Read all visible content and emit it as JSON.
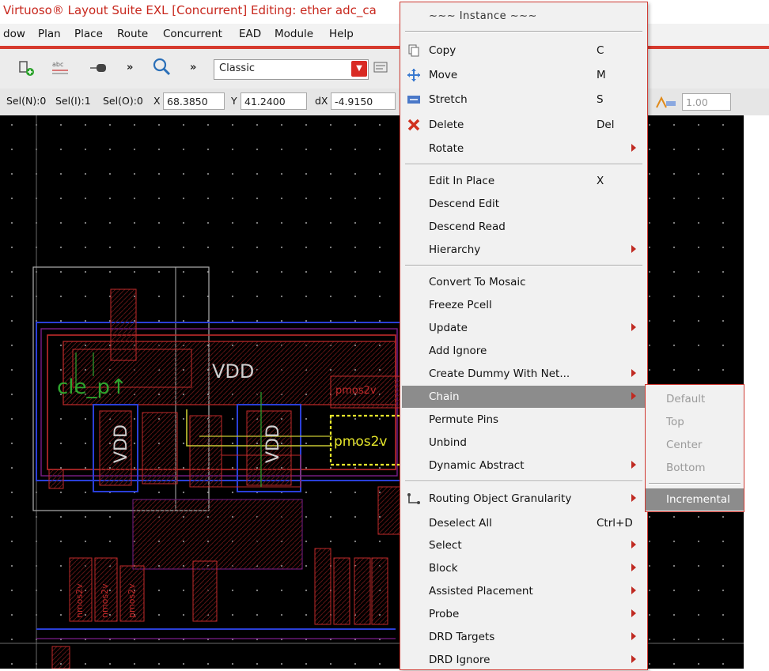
{
  "window": {
    "title": "Virtuoso® Layout Suite EXL [Concurrent] Editing: ether adc_ca"
  },
  "menubar": {
    "items": [
      "dow",
      "Plan",
      "Place",
      "Route",
      "Concurrent",
      "EAD",
      "Module",
      "Help"
    ]
  },
  "toolbar": {
    "mode_select": "Classic",
    "icons": [
      "create-instance-icon",
      "create-label-icon",
      "create-pin-icon",
      "more-icon",
      "zoom-icon",
      "more-icon",
      "options-icon"
    ],
    "more_glyph": "»",
    "right_value": "1.00"
  },
  "coordbar": {
    "sel_n": "Sel(N):0",
    "sel_i": "Sel(I):1",
    "sel_o": "Sel(O):0",
    "x_label": "X",
    "x_value": "68.3850",
    "y_label": "Y",
    "y_value": "41.2400",
    "dx_label": "dX",
    "dx_value": "-4.9150"
  },
  "canvas": {
    "labels": {
      "vdd_top": "VDD",
      "cle": "cle_p↑",
      "vdd_rot1": "VDD",
      "vdd_rot2": "VDD",
      "pmos_sel": "pmos2v",
      "pmos_top": "pmos2v",
      "nmos_a": "nmos2v",
      "nmos_b": "nmos2v",
      "pmos_c": "pmos2v"
    },
    "colors": {
      "background": "#000000",
      "grid": "#8a8a8a",
      "metal1": "#2a3fd8",
      "poly": "#c02a2a",
      "selection": "#e6e62a",
      "outline": "#b0b0b0"
    }
  },
  "context_menu": {
    "header": "~~~ Instance ~~~",
    "groups": [
      [
        {
          "label": "Copy",
          "shortcut": "C",
          "icon": "copy-icon",
          "submenu": false
        },
        {
          "label": "Move",
          "shortcut": "M",
          "icon": "move-icon",
          "submenu": false
        },
        {
          "label": "Stretch",
          "shortcut": "S",
          "icon": "stretch-icon",
          "submenu": false
        },
        {
          "label": "Delete",
          "shortcut": "Del",
          "icon": "delete-icon",
          "submenu": false
        },
        {
          "label": "Rotate",
          "shortcut": "",
          "icon": "",
          "submenu": true
        }
      ],
      [
        {
          "label": "Edit In Place",
          "shortcut": "X",
          "icon": "",
          "submenu": false
        },
        {
          "label": "Descend Edit",
          "shortcut": "",
          "icon": "",
          "submenu": false
        },
        {
          "label": "Descend Read",
          "shortcut": "",
          "icon": "",
          "submenu": false
        },
        {
          "label": "Hierarchy",
          "shortcut": "",
          "icon": "",
          "submenu": true
        }
      ],
      [
        {
          "label": "Convert To Mosaic",
          "shortcut": "",
          "icon": "",
          "submenu": false
        },
        {
          "label": "Freeze Pcell",
          "shortcut": "",
          "icon": "",
          "submenu": false
        },
        {
          "label": "Update",
          "shortcut": "",
          "icon": "",
          "submenu": true
        },
        {
          "label": "Add Ignore",
          "shortcut": "",
          "icon": "",
          "submenu": false
        },
        {
          "label": "Create Dummy With Net...",
          "shortcut": "",
          "icon": "",
          "submenu": true
        },
        {
          "label": "Chain",
          "shortcut": "",
          "icon": "",
          "submenu": true,
          "highlighted": true
        },
        {
          "label": "Permute Pins",
          "shortcut": "",
          "icon": "",
          "submenu": false
        },
        {
          "label": "Unbind",
          "shortcut": "",
          "icon": "",
          "submenu": false
        },
        {
          "label": "Dynamic Abstract",
          "shortcut": "",
          "icon": "",
          "submenu": true
        }
      ],
      [
        {
          "label": "Routing Object Granularity",
          "shortcut": "",
          "icon": "routing-granularity-icon",
          "submenu": true
        },
        {
          "label": "Deselect All",
          "shortcut": "Ctrl+D",
          "icon": "",
          "submenu": false
        },
        {
          "label": "Select",
          "shortcut": "",
          "icon": "",
          "submenu": true
        },
        {
          "label": "Block",
          "shortcut": "",
          "icon": "",
          "submenu": true
        },
        {
          "label": "Assisted Placement",
          "shortcut": "",
          "icon": "",
          "submenu": true
        },
        {
          "label": "Probe",
          "shortcut": "",
          "icon": "",
          "submenu": true
        },
        {
          "label": "DRD Targets",
          "shortcut": "",
          "icon": "",
          "submenu": true
        },
        {
          "label": "DRD Ignore",
          "shortcut": "",
          "icon": "",
          "submenu": true
        }
      ]
    ]
  },
  "chain_submenu": {
    "items": [
      {
        "label": "Default",
        "enabled": false
      },
      {
        "label": "Top",
        "enabled": false
      },
      {
        "label": "Center",
        "enabled": false
      },
      {
        "label": "Bottom",
        "enabled": false
      },
      {
        "label": "Incremental",
        "enabled": true,
        "highlighted": true
      }
    ]
  }
}
